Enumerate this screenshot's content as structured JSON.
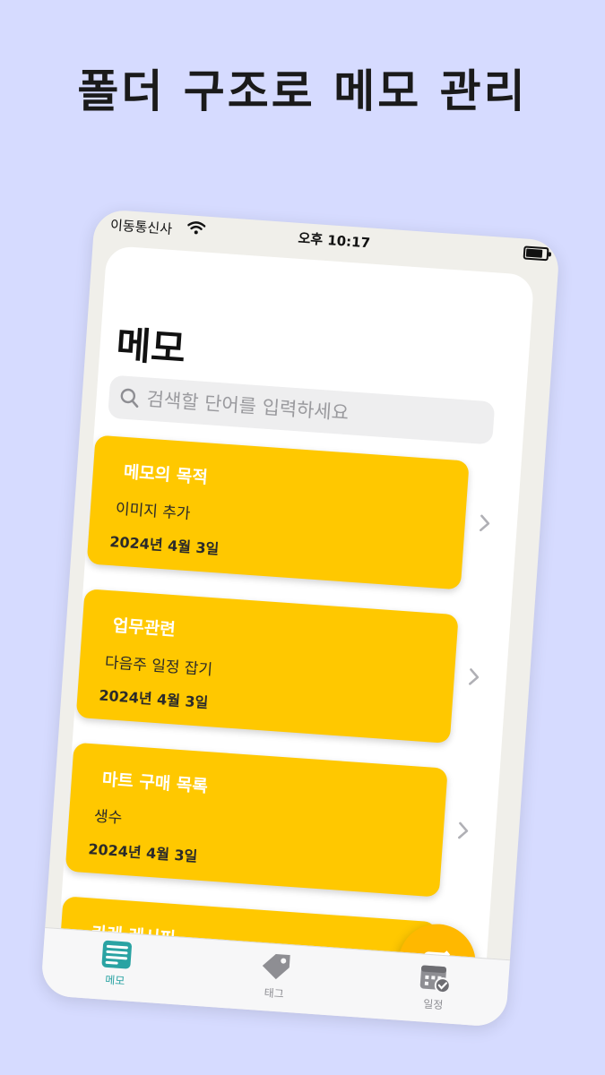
{
  "headline": "폴더 구조로 메모 관리",
  "status_bar": {
    "carrier": "이동통신사",
    "time": "오후 10:17",
    "battery_level": 0.9
  },
  "page": {
    "title": "메모"
  },
  "search": {
    "placeholder": "검색할 단어를 입력하세요",
    "icon": "search-icon"
  },
  "memos": [
    {
      "name": "메모의 목적",
      "preview": "이미지 추가",
      "date": "2024년 4월 3일"
    },
    {
      "name": "업무관련",
      "preview": "다음주 일정 잡기",
      "date": "2024년 4월 3일"
    },
    {
      "name": "마트 구매 목록",
      "preview": "생수",
      "date": "2024년 4월 3일"
    },
    {
      "name": "카레 레시피",
      "preview": "",
      "date": ""
    }
  ],
  "fab": {
    "icon": "compose-icon"
  },
  "tabs": [
    {
      "label": "메모",
      "icon": "memo-list-icon",
      "active": true
    },
    {
      "label": "태그",
      "icon": "tag-icon",
      "active": false
    },
    {
      "label": "일정",
      "icon": "calendar-check-icon",
      "active": false
    }
  ],
  "colors": {
    "background": "#d6dbff",
    "card": "#ffc800",
    "fab": "#ffb800",
    "active_tab": "#2aa3a3",
    "inactive_tab": "#8e8e93"
  }
}
